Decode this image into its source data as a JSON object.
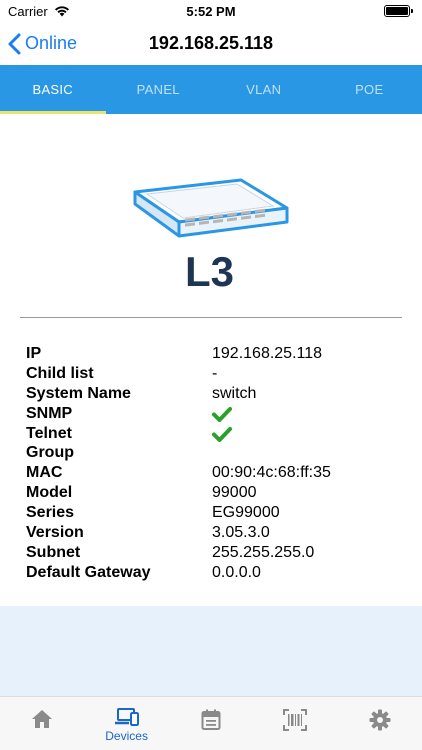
{
  "status_bar": {
    "carrier": "Carrier",
    "time": "5:52 PM"
  },
  "nav": {
    "back_label": "Online",
    "title": "192.168.25.118"
  },
  "tabs": [
    {
      "label": "BASIC",
      "active": true
    },
    {
      "label": "PANEL",
      "active": false
    },
    {
      "label": "VLAN",
      "active": false
    },
    {
      "label": "POE",
      "active": false
    }
  ],
  "device": {
    "layer_label": "L3"
  },
  "info": [
    {
      "label": "IP",
      "value": "192.168.25.118"
    },
    {
      "label": "Child list",
      "value": "-"
    },
    {
      "label": "System Name",
      "value": "switch"
    },
    {
      "label": "SNMP",
      "value": "",
      "icon": "checkmark-icon"
    },
    {
      "label": "Telnet",
      "value": "",
      "icon": "checkmark-icon"
    },
    {
      "label": "Group",
      "value": ""
    },
    {
      "label": "MAC",
      "value": "00:90:4c:68:ff:35"
    },
    {
      "label": "Model",
      "value": "99000"
    },
    {
      "label": "Series",
      "value": "EG99000"
    },
    {
      "label": "Version",
      "value": "3.05.3.0"
    },
    {
      "label": "Subnet",
      "value": "255.255.255.0"
    },
    {
      "label": "Default Gateway",
      "value": "0.0.0.0"
    }
  ],
  "bottom_tabs": [
    {
      "icon": "home-icon",
      "label": ""
    },
    {
      "icon": "devices-icon",
      "label": "Devices"
    },
    {
      "icon": "calendar-icon",
      "label": ""
    },
    {
      "icon": "barcode-scan-icon",
      "label": ""
    },
    {
      "icon": "gear-icon",
      "label": ""
    }
  ],
  "colors": {
    "accent": "#1a7cf6",
    "tab_bar": "#2a97e4",
    "active_indicator": "#e9e56b",
    "check": "#2aa12a",
    "footer_background": "#e7f1fc"
  }
}
